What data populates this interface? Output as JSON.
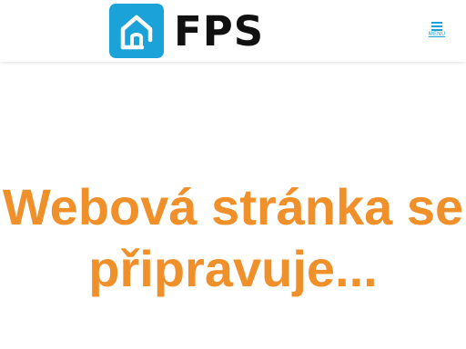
{
  "header": {
    "logo_text": "FPS",
    "logo_icon": "house-icon",
    "logo_color": "#1aa2d9",
    "menu_icon": "hamburger-icon",
    "menu_label": "MENU",
    "menu_color": "#1aa2d9"
  },
  "main": {
    "headline": "Webová stránka se připravuje...",
    "headline_color": "#f0902b"
  }
}
